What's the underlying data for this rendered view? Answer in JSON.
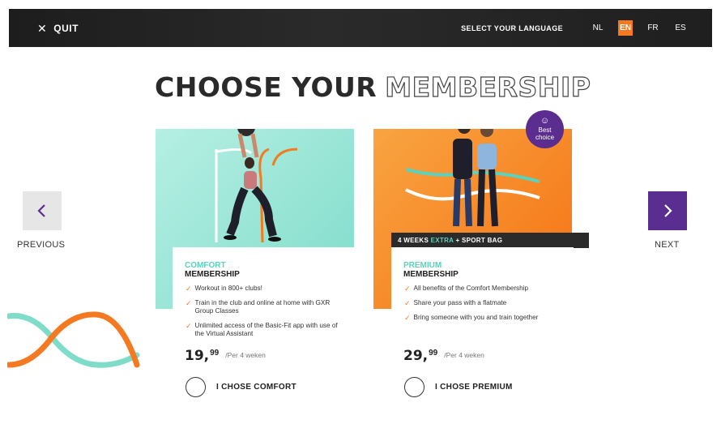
{
  "topbar": {
    "quit_label": "QUIT",
    "language_label": "SELECT YOUR LANGUAGE",
    "languages": [
      "NL",
      "EN",
      "FR",
      "ES"
    ],
    "active_language": "EN"
  },
  "title": {
    "solid": "CHOOSE YOUR",
    "outline": "MEMBERSHIP"
  },
  "nav": {
    "previous": "PREVIOUS",
    "next": "NEXT"
  },
  "colors": {
    "orange": "#f47920",
    "purple": "#5a2d91",
    "mint": "#59d3be",
    "dark": "#2b2b2b"
  },
  "cards": [
    {
      "name": "COMFORT",
      "subtitle": "MEMBERSHIP",
      "features": [
        "Workout in 800+ clubs!",
        "Train in the club and online at home with GXR Group Classes",
        "Unlimited access of the Basic-Fit app with use of the Virtual Assistant"
      ],
      "price_main": "19,",
      "price_dec": "99",
      "price_per": "/Per 4 weken",
      "choose_label": "I CHOSE COMFORT"
    },
    {
      "name": "PREMIUM",
      "subtitle": "MEMBERSHIP",
      "badge": [
        "Best",
        "choice"
      ],
      "promo": {
        "weeks": "4 WEEKS",
        "extra": "EXTRA",
        "rest": "+ SPORT BAG"
      },
      "features": [
        "All benefits of the Comfort Membership",
        "Share your pass with a flatmate",
        "Bring someone with you and train together"
      ],
      "price_main": "29,",
      "price_dec": "99",
      "price_per": "/Per 4 weken",
      "choose_label": "I CHOSE PREMIUM"
    }
  ]
}
